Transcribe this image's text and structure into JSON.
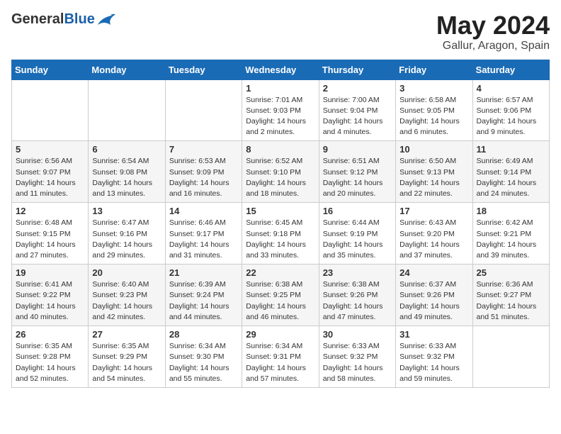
{
  "header": {
    "logo_general": "General",
    "logo_blue": "Blue",
    "month_year": "May 2024",
    "location": "Gallur, Aragon, Spain"
  },
  "days_of_week": [
    "Sunday",
    "Monday",
    "Tuesday",
    "Wednesday",
    "Thursday",
    "Friday",
    "Saturday"
  ],
  "weeks": [
    [
      {
        "day": "",
        "content": ""
      },
      {
        "day": "",
        "content": ""
      },
      {
        "day": "",
        "content": ""
      },
      {
        "day": "1",
        "content": "Sunrise: 7:01 AM\nSunset: 9:03 PM\nDaylight: 14 hours\nand 2 minutes."
      },
      {
        "day": "2",
        "content": "Sunrise: 7:00 AM\nSunset: 9:04 PM\nDaylight: 14 hours\nand 4 minutes."
      },
      {
        "day": "3",
        "content": "Sunrise: 6:58 AM\nSunset: 9:05 PM\nDaylight: 14 hours\nand 6 minutes."
      },
      {
        "day": "4",
        "content": "Sunrise: 6:57 AM\nSunset: 9:06 PM\nDaylight: 14 hours\nand 9 minutes."
      }
    ],
    [
      {
        "day": "5",
        "content": "Sunrise: 6:56 AM\nSunset: 9:07 PM\nDaylight: 14 hours\nand 11 minutes."
      },
      {
        "day": "6",
        "content": "Sunrise: 6:54 AM\nSunset: 9:08 PM\nDaylight: 14 hours\nand 13 minutes."
      },
      {
        "day": "7",
        "content": "Sunrise: 6:53 AM\nSunset: 9:09 PM\nDaylight: 14 hours\nand 16 minutes."
      },
      {
        "day": "8",
        "content": "Sunrise: 6:52 AM\nSunset: 9:10 PM\nDaylight: 14 hours\nand 18 minutes."
      },
      {
        "day": "9",
        "content": "Sunrise: 6:51 AM\nSunset: 9:12 PM\nDaylight: 14 hours\nand 20 minutes."
      },
      {
        "day": "10",
        "content": "Sunrise: 6:50 AM\nSunset: 9:13 PM\nDaylight: 14 hours\nand 22 minutes."
      },
      {
        "day": "11",
        "content": "Sunrise: 6:49 AM\nSunset: 9:14 PM\nDaylight: 14 hours\nand 24 minutes."
      }
    ],
    [
      {
        "day": "12",
        "content": "Sunrise: 6:48 AM\nSunset: 9:15 PM\nDaylight: 14 hours\nand 27 minutes."
      },
      {
        "day": "13",
        "content": "Sunrise: 6:47 AM\nSunset: 9:16 PM\nDaylight: 14 hours\nand 29 minutes."
      },
      {
        "day": "14",
        "content": "Sunrise: 6:46 AM\nSunset: 9:17 PM\nDaylight: 14 hours\nand 31 minutes."
      },
      {
        "day": "15",
        "content": "Sunrise: 6:45 AM\nSunset: 9:18 PM\nDaylight: 14 hours\nand 33 minutes."
      },
      {
        "day": "16",
        "content": "Sunrise: 6:44 AM\nSunset: 9:19 PM\nDaylight: 14 hours\nand 35 minutes."
      },
      {
        "day": "17",
        "content": "Sunrise: 6:43 AM\nSunset: 9:20 PM\nDaylight: 14 hours\nand 37 minutes."
      },
      {
        "day": "18",
        "content": "Sunrise: 6:42 AM\nSunset: 9:21 PM\nDaylight: 14 hours\nand 39 minutes."
      }
    ],
    [
      {
        "day": "19",
        "content": "Sunrise: 6:41 AM\nSunset: 9:22 PM\nDaylight: 14 hours\nand 40 minutes."
      },
      {
        "day": "20",
        "content": "Sunrise: 6:40 AM\nSunset: 9:23 PM\nDaylight: 14 hours\nand 42 minutes."
      },
      {
        "day": "21",
        "content": "Sunrise: 6:39 AM\nSunset: 9:24 PM\nDaylight: 14 hours\nand 44 minutes."
      },
      {
        "day": "22",
        "content": "Sunrise: 6:38 AM\nSunset: 9:25 PM\nDaylight: 14 hours\nand 46 minutes."
      },
      {
        "day": "23",
        "content": "Sunrise: 6:38 AM\nSunset: 9:26 PM\nDaylight: 14 hours\nand 47 minutes."
      },
      {
        "day": "24",
        "content": "Sunrise: 6:37 AM\nSunset: 9:26 PM\nDaylight: 14 hours\nand 49 minutes."
      },
      {
        "day": "25",
        "content": "Sunrise: 6:36 AM\nSunset: 9:27 PM\nDaylight: 14 hours\nand 51 minutes."
      }
    ],
    [
      {
        "day": "26",
        "content": "Sunrise: 6:35 AM\nSunset: 9:28 PM\nDaylight: 14 hours\nand 52 minutes."
      },
      {
        "day": "27",
        "content": "Sunrise: 6:35 AM\nSunset: 9:29 PM\nDaylight: 14 hours\nand 54 minutes."
      },
      {
        "day": "28",
        "content": "Sunrise: 6:34 AM\nSunset: 9:30 PM\nDaylight: 14 hours\nand 55 minutes."
      },
      {
        "day": "29",
        "content": "Sunrise: 6:34 AM\nSunset: 9:31 PM\nDaylight: 14 hours\nand 57 minutes."
      },
      {
        "day": "30",
        "content": "Sunrise: 6:33 AM\nSunset: 9:32 PM\nDaylight: 14 hours\nand 58 minutes."
      },
      {
        "day": "31",
        "content": "Sunrise: 6:33 AM\nSunset: 9:32 PM\nDaylight: 14 hours\nand 59 minutes."
      },
      {
        "day": "",
        "content": ""
      }
    ]
  ]
}
